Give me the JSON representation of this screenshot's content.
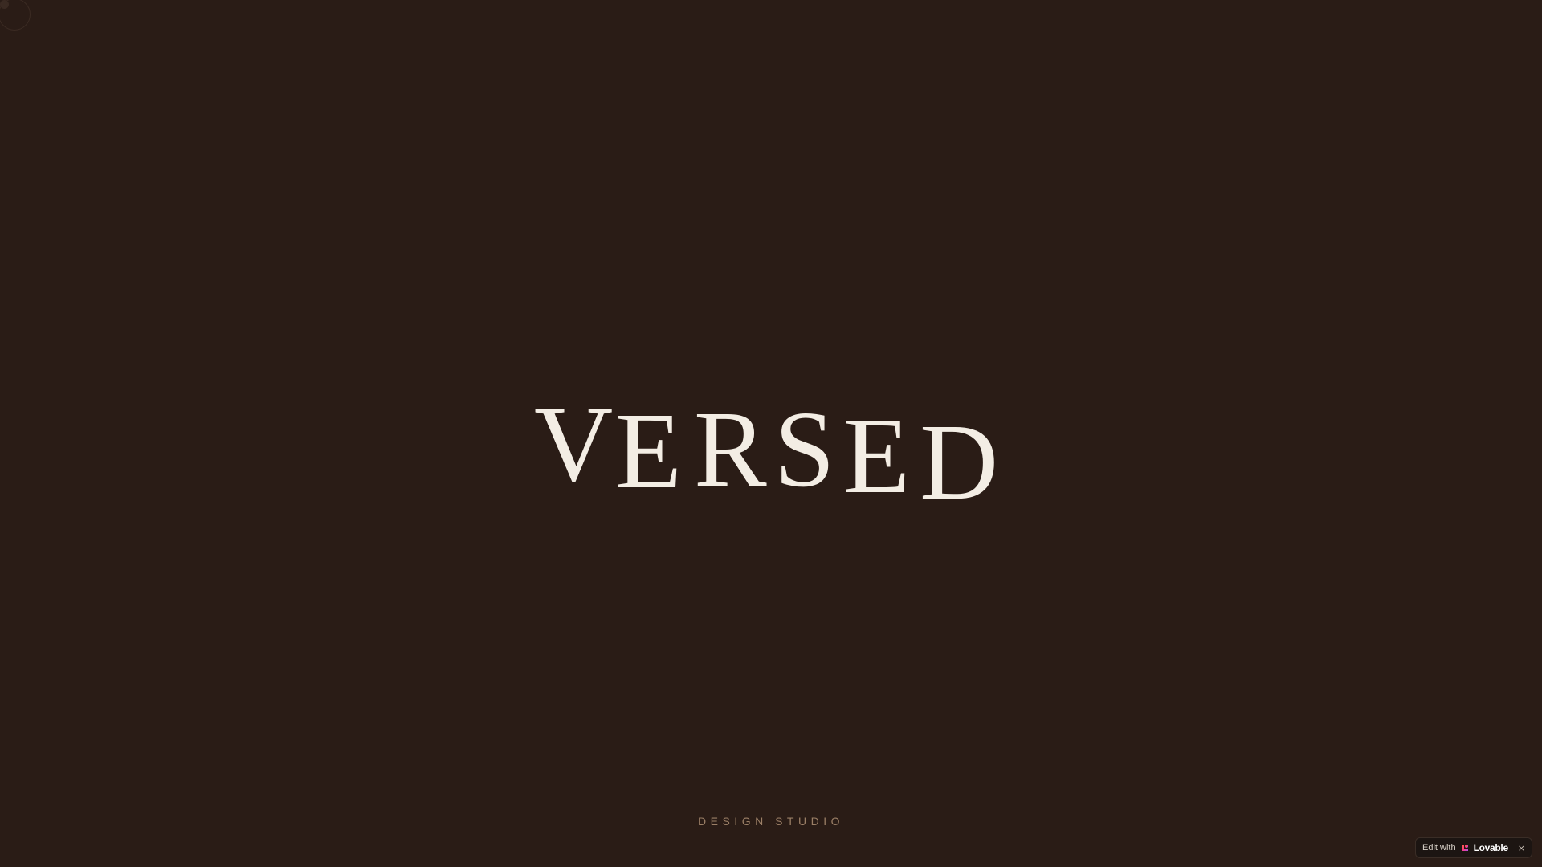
{
  "brand": {
    "letters": [
      "V",
      "E",
      "R",
      "S",
      "E",
      "D"
    ],
    "tagline": "DESIGN STUDIO"
  },
  "badge": {
    "prefix": "Edit with",
    "brand_name": "Lovable",
    "close_glyph": "×",
    "icon": "heart-icon"
  },
  "colors": {
    "background": "#2a1c16",
    "wordmark": "#f3ede4",
    "tagline": "#9b7f66"
  }
}
